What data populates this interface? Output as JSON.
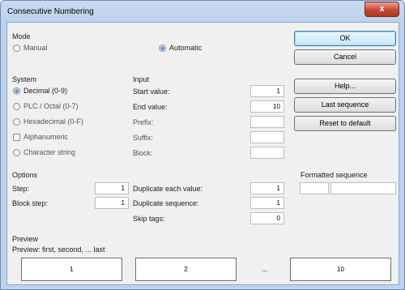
{
  "window": {
    "title": "Consecutive Numbering",
    "close_glyph": "x"
  },
  "mode": {
    "label": "Mode",
    "manual": {
      "label": "Manual",
      "checked": false
    },
    "automatic": {
      "label": "Automatic",
      "checked": true
    }
  },
  "buttons": {
    "ok": "OK",
    "cancel": "Cancel",
    "help": "Help...",
    "last_sequence": "Last sequence",
    "reset": "Reset to default"
  },
  "system": {
    "label": "System",
    "options": [
      {
        "label": "Decimal (0-9)",
        "checked": true
      },
      {
        "label": "PLC / Octal (0-7)",
        "checked": false
      },
      {
        "label": "Hexadecimal (0-F)",
        "checked": false
      },
      {
        "label": "Alphanumeric",
        "checked": false,
        "kind": "checkbox"
      },
      {
        "label": "Character string",
        "checked": false
      }
    ]
  },
  "input": {
    "label": "Input",
    "start_value": {
      "label": "Start value:",
      "value": "1"
    },
    "end_value": {
      "label": "End value:",
      "value": "10"
    },
    "prefix": {
      "label": "Prefix:",
      "value": ""
    },
    "suffix": {
      "label": "Suffix:",
      "value": ""
    },
    "block": {
      "label": "Block:",
      "value": ""
    }
  },
  "options": {
    "label": "Options",
    "step": {
      "label": "Step:",
      "value": "1"
    },
    "block_step": {
      "label": "Block step:",
      "value": "1"
    },
    "duplicate_each": {
      "label": "Duplicate each value:",
      "value": "1"
    },
    "duplicate_sequence": {
      "label": "Duplicate sequence:",
      "value": "1"
    },
    "skip_tags": {
      "label": "Skip tags:",
      "value": "0"
    }
  },
  "formatted_sequence": {
    "label": "Formatted sequence",
    "part1": "",
    "part2": ""
  },
  "preview": {
    "label": "Preview",
    "caption": "Preview: first, second, ... last",
    "first": "1",
    "second": "2",
    "ellipsis": "...",
    "last": "10"
  },
  "colors": {
    "accent": "#3c7fb1",
    "close": "#c8462f",
    "title_bar": "#bcd2ee"
  }
}
